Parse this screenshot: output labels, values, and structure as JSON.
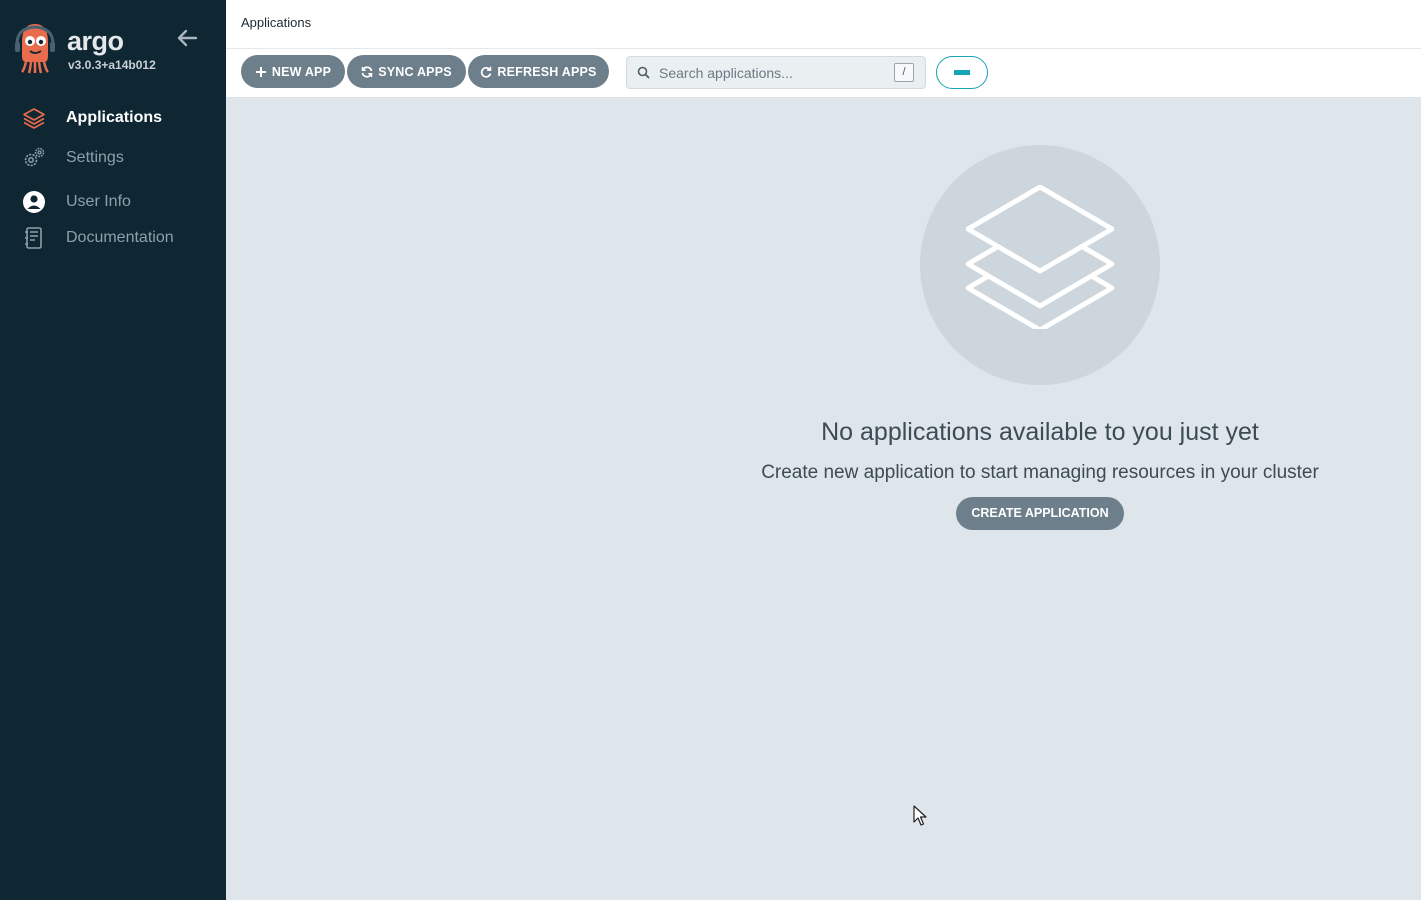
{
  "sidebar": {
    "brand": "argo",
    "version": "v3.0.3+a14b012",
    "collapse_icon": "arrow-left-icon",
    "items": [
      {
        "label": "Applications",
        "icon": "layers-icon",
        "active": true
      },
      {
        "label": "Settings",
        "icon": "gears-icon",
        "active": false
      },
      {
        "label": "User Info",
        "icon": "user-circle-icon",
        "active": false
      },
      {
        "label": "Documentation",
        "icon": "book-icon",
        "active": false
      }
    ]
  },
  "header": {
    "title": "Applications"
  },
  "toolbar": {
    "new_app": "NEW APP",
    "sync_apps": "SYNC APPS",
    "refresh_apps": "REFRESH APPS",
    "search_placeholder": "Search applications...",
    "search_shortcut": "/"
  },
  "empty_state": {
    "title": "No applications available to you just yet",
    "subtitle": "Create new application to start managing resources in your cluster",
    "button": "CREATE APPLICATION"
  },
  "colors": {
    "sidebar_bg": "#0f2633",
    "content_bg": "#dee6eb",
    "button_bg": "#6d7f8b",
    "accent_teal": "#17a3b8",
    "active_icon": "#e96d4c"
  }
}
